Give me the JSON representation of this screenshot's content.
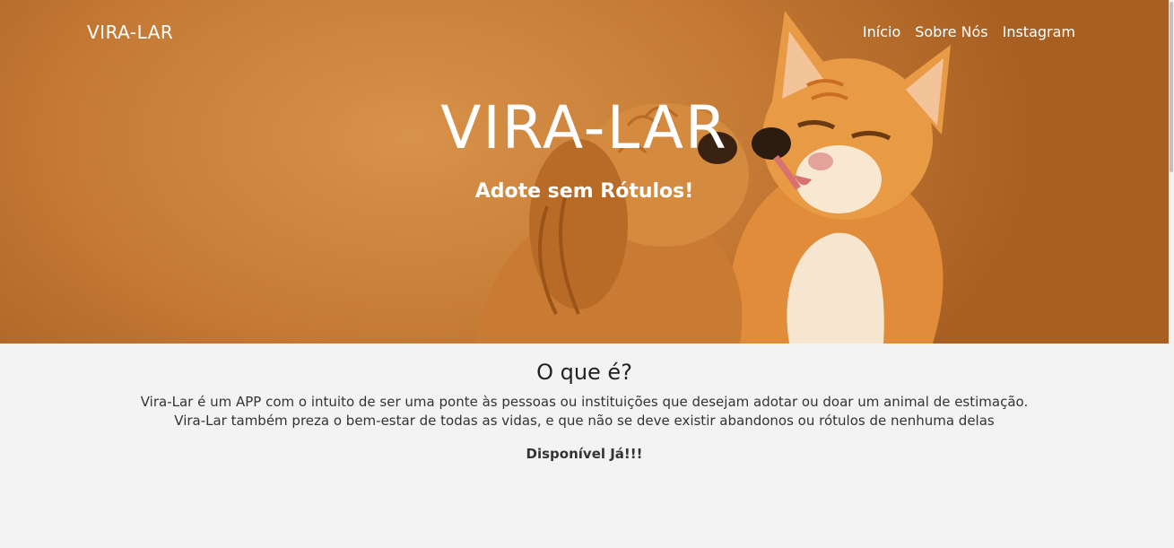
{
  "nav": {
    "brand": "VIRA-LAR",
    "links": [
      {
        "label": "Início"
      },
      {
        "label": "Sobre Nós"
      },
      {
        "label": "Instagram"
      }
    ]
  },
  "hero": {
    "title": "VIRA-LAR",
    "subtitle": "Adote sem Rótulos!"
  },
  "about": {
    "heading": "O que é?",
    "line1": "Vira-Lar é um APP com o intuito de ser uma ponte às pessoas ou instituições que desejam adotar ou doar um animal de estimação.",
    "line2": "Vira-Lar também preza o bem-estar de todas as vidas, e que não se deve existir abandonos ou rótulos de nenhuma delas",
    "availability": "Disponível Já!!!"
  }
}
